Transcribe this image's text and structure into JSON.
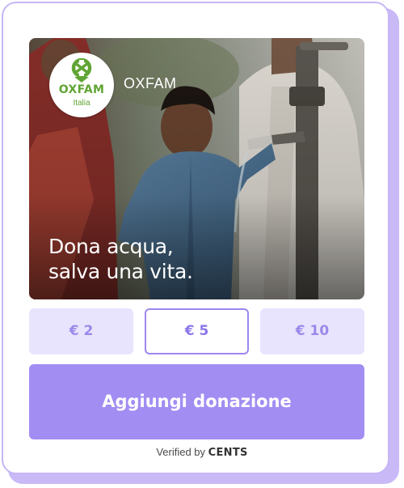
{
  "campaign": {
    "org_name": "OXFAM",
    "logo_text": "OXFAM",
    "logo_subtext": "Italia",
    "headline_line1": "Dona acqua,",
    "headline_line2": "salva una vita.",
    "hero_image": "child-at-water-pump-photo"
  },
  "donation": {
    "amounts": [
      {
        "label": "€ 2",
        "selected": false
      },
      {
        "label": "€ 5",
        "selected": true
      },
      {
        "label": "€ 10",
        "selected": false
      }
    ],
    "cta_label": "Aggiungi donazione"
  },
  "footer": {
    "verified_label": "Verified by",
    "verified_brand": "CENTS"
  },
  "colors": {
    "accent": "#a28df3",
    "accent_light": "#e9e4fd",
    "border": "#c7b6f6",
    "oxfam_green": "#61a534"
  }
}
